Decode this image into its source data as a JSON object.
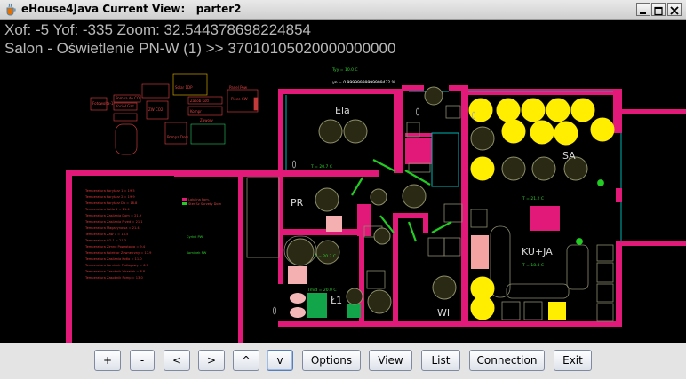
{
  "window": {
    "title": "eHouse4Java Current View:   parter2"
  },
  "status": {
    "offsets_line": "Xof: -5 Yof: -335 Zoom: 32.544378698224854",
    "selection_line": "Salon - Oświetlenie PN-W (1) >> 37010105020000000000"
  },
  "plan": {
    "rooms": {
      "ela": "Ela",
      "sa": "SA",
      "pr": "PR",
      "kuja": "KU+JA",
      "l1": "Ł1",
      "wi": "WI"
    },
    "temps": {
      "top1": "Tyy = 10.0 C",
      "top2": "Lyn = 0.99999999999999432 %",
      "ela": "T = 20.7 C",
      "sa": "T = 21.2 C",
      "pr": "T = 20.3 C",
      "kuja": "T = 18.8 C",
      "l1": "Tmid = 20.0 C"
    },
    "sensor_lines": [
      "Temperatura Korytarz 1 = 19.5",
      "Temperatura Korytarz 2 = 19.9",
      "Temperatura Korytarz Do = 18.8",
      "Temperatura Kotlo 1 = 21.4",
      "Temperatura Zasilania Dom = 21.9",
      "Temperatura Zasilania Przed = 21.1",
      "Temperatura Magazynowa = 21.4",
      "Temperatura Zaw 1 = 18.5",
      "Temperatura CO 1 = 21.3",
      "Temperatura Zimno Powrotowa = 9.4",
      "Temperatura Kolektor Zewnetrzny = 17.9",
      "Temperatura Zasilania Kotlo = 11.0",
      "Temperatura Kominek Podlogowy = 6.7",
      "Temperatura Zasobnik Wrzatek = 8.8",
      "Temperatura Zasobnik Pomp = 13.0"
    ],
    "legend": [
      "Lokalna Pom.",
      "Ster Sz Sprzety Dom"
    ],
    "side_labels": [
      "Cyrkul PW",
      "Kominek PW"
    ],
    "diagram_boxes": [
      "Fotowolta-1",
      "Pompa do CO",
      "Kocioł Gaz",
      "Solar 1DP",
      "Zasob Kotl",
      "ZW CO2",
      "Kompr",
      "Panel Pow",
      "Zawory",
      "Pompa Dom",
      "Piece CW"
    ],
    "colors": {
      "wall": "#e3197a",
      "lamp_on": "#ffee00",
      "lamp_off": "#2a2a14",
      "lamp_stroke": "#8f8f6a",
      "window": "#00b4b4",
      "door": "#22cc22"
    }
  },
  "toolbar": {
    "plus": "+",
    "minus": "-",
    "left": "<",
    "right": ">",
    "up": "^",
    "down": "v",
    "options": "Options",
    "view": "View",
    "list": "List",
    "connection": "Connection",
    "exit": "Exit"
  }
}
